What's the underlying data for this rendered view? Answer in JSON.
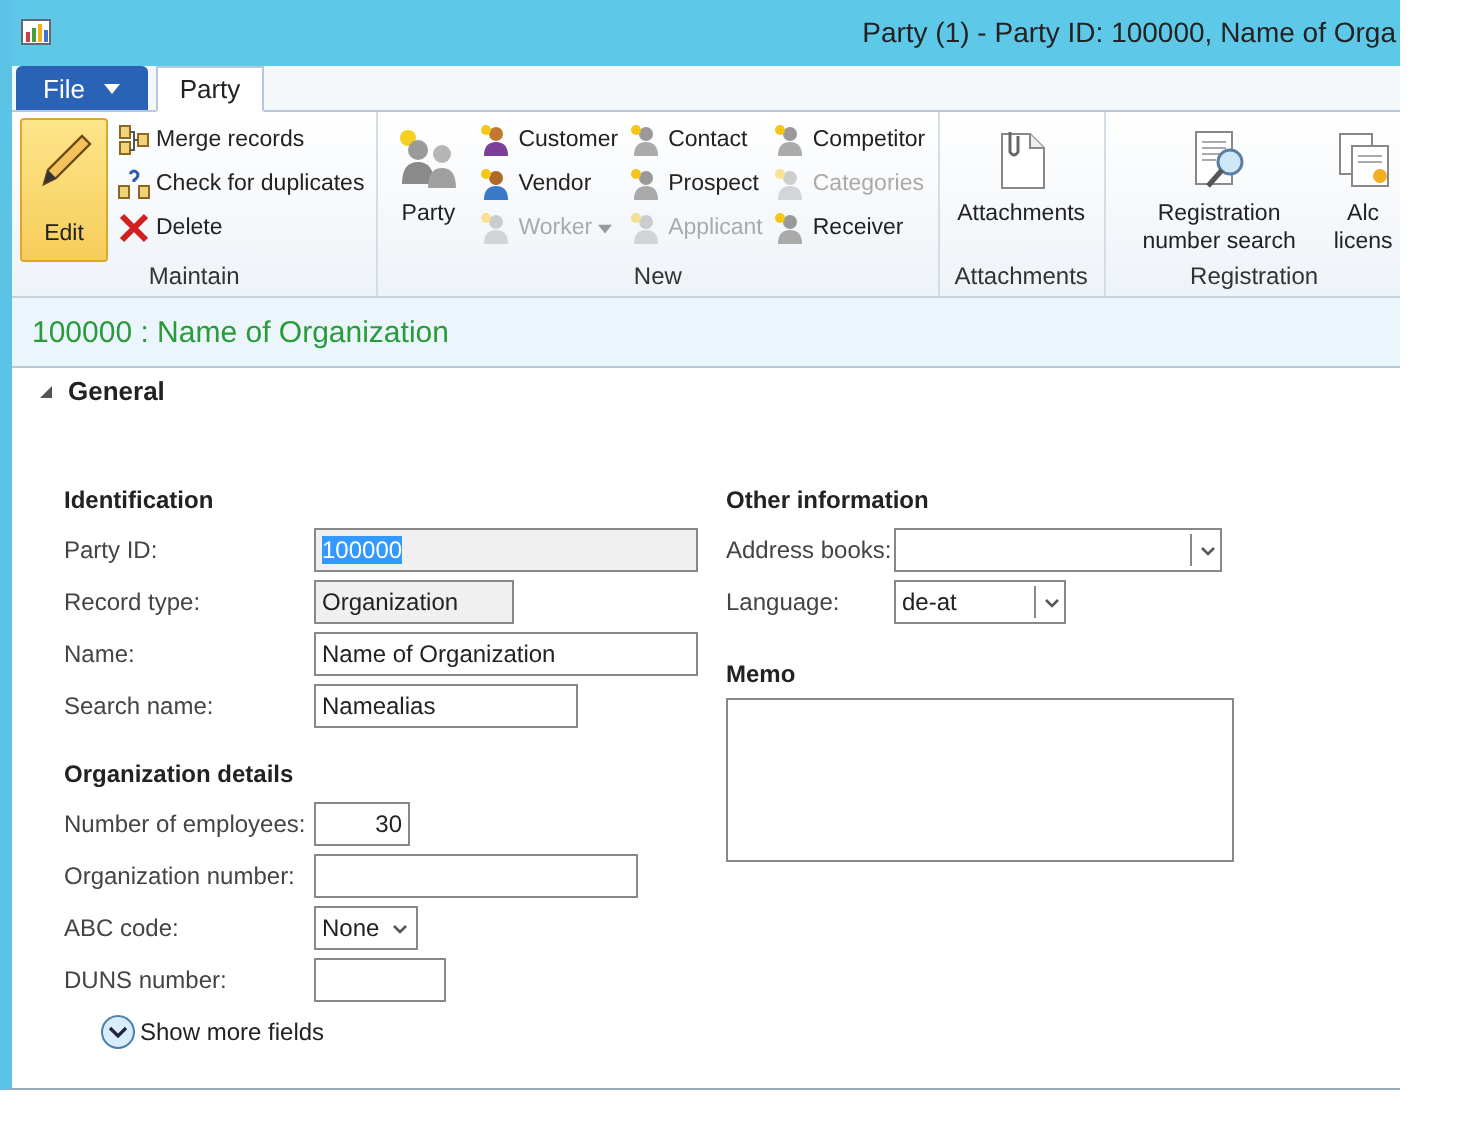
{
  "window": {
    "title": "Party (1) - Party ID: 100000, Name of Orga"
  },
  "tabs": [
    {
      "label": "File",
      "kind": "menu",
      "selected": false
    },
    {
      "label": "Party",
      "kind": "tab",
      "selected": true
    }
  ],
  "ribbon": {
    "groups": [
      {
        "label": "Maintain",
        "items": [
          {
            "label": "Edit",
            "kind": "large",
            "on": true,
            "disabled": false,
            "dropdown": false
          },
          {
            "label": "Merge records",
            "kind": "small",
            "on": false,
            "disabled": false,
            "dropdown": false
          },
          {
            "label": "Check for duplicates",
            "kind": "small",
            "on": false,
            "disabled": false,
            "dropdown": false
          },
          {
            "label": "Delete",
            "kind": "small",
            "on": false,
            "disabled": false,
            "dropdown": false
          }
        ]
      },
      {
        "label": "New",
        "items": [
          {
            "label": "Party",
            "kind": "large",
            "on": false,
            "disabled": false,
            "dropdown": false
          },
          {
            "label": "Customer",
            "kind": "small",
            "on": false,
            "disabled": false,
            "dropdown": false
          },
          {
            "label": "Vendor",
            "kind": "small",
            "on": false,
            "disabled": false,
            "dropdown": false
          },
          {
            "label": "Worker",
            "kind": "small",
            "on": false,
            "disabled": true,
            "dropdown": true
          },
          {
            "label": "Contact",
            "kind": "small",
            "on": false,
            "disabled": false,
            "dropdown": false
          },
          {
            "label": "Prospect",
            "kind": "small",
            "on": false,
            "disabled": false,
            "dropdown": false
          },
          {
            "label": "Applicant",
            "kind": "small",
            "on": false,
            "disabled": true,
            "dropdown": false
          },
          {
            "label": "Competitor",
            "kind": "small",
            "on": false,
            "disabled": false,
            "dropdown": false
          },
          {
            "label": "Categories",
            "kind": "small",
            "on": false,
            "disabled": true,
            "dropdown": false
          },
          {
            "label": "Receiver",
            "kind": "small",
            "on": false,
            "disabled": false,
            "dropdown": false
          }
        ]
      },
      {
        "label": "Attachments",
        "items": [
          {
            "label": "Attachments",
            "kind": "large",
            "on": false,
            "disabled": false,
            "dropdown": false
          }
        ]
      },
      {
        "label": "Registration",
        "items": [
          {
            "label": "Registration number search",
            "kind": "large",
            "on": false,
            "disabled": false,
            "dropdown": false
          },
          {
            "label": "Alc licens",
            "kind": "large",
            "on": false,
            "disabled": false,
            "dropdown": false
          }
        ]
      }
    ]
  },
  "record_header": {
    "title": "100000 : Name of Organization"
  },
  "section": {
    "title": "General",
    "expanded": true
  },
  "left_groups": [
    {
      "title": "Identification",
      "fields": [
        {
          "label": "Party ID:",
          "value": "100000",
          "kind": "text",
          "readonly": true,
          "text_selected": true
        },
        {
          "label": "Record type:",
          "value": "Organization",
          "kind": "text",
          "readonly": true,
          "text_selected": false
        },
        {
          "label": "Name:",
          "value": "Name of Organization",
          "kind": "text",
          "readonly": false,
          "text_selected": false
        },
        {
          "label": "Search name:",
          "value": "Namealias",
          "kind": "text",
          "readonly": false,
          "text_selected": false
        }
      ]
    },
    {
      "title": "Organization details",
      "fields": [
        {
          "label": "Number of employees:",
          "value": "30",
          "kind": "number",
          "readonly": false,
          "text_selected": false
        },
        {
          "label": "Organization number:",
          "kind": "text",
          "readonly": false
        },
        {
          "label": "ABC code:",
          "value": "None",
          "kind": "select",
          "readonly": false,
          "text_selected": false
        },
        {
          "label": "DUNS number:",
          "kind": "text",
          "readonly": false
        }
      ]
    }
  ],
  "show_more": {
    "label": "Show more fields"
  },
  "right_group": {
    "title": "Other information",
    "fields": [
      {
        "label": "Address books:",
        "kind": "combo",
        "readonly": false
      },
      {
        "label": "Language:",
        "value": "de-at",
        "kind": "combo",
        "readonly": false,
        "text_selected": false
      }
    ]
  },
  "memo": {
    "title": "Memo"
  }
}
